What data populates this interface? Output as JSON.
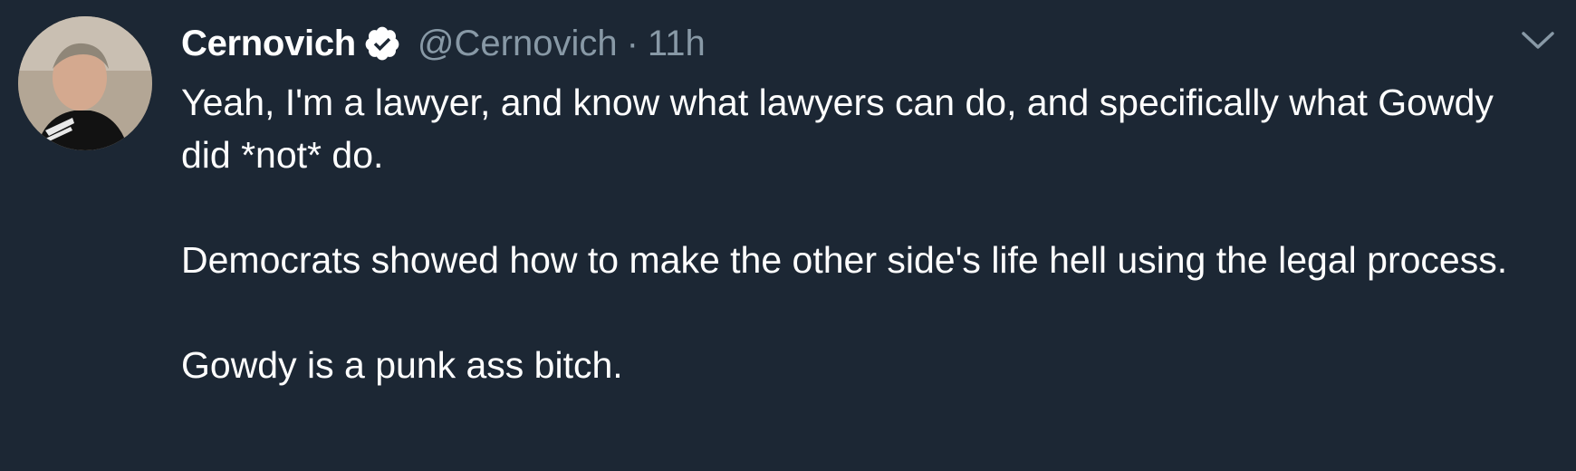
{
  "tweet": {
    "display_name": "Cernovich",
    "handle": "@Cernovich",
    "separator": "·",
    "time": "11h",
    "verified": true,
    "paragraphs": [
      "Yeah, I'm a lawyer, and know what lawyers can do, and specifically what Gowdy did *not* do.",
      "Democrats showed how to make the other side's life hell using the legal process.",
      "Gowdy is a punk ass bitch."
    ]
  },
  "colors": {
    "background": "#1c2734",
    "text": "#ffffff",
    "muted": "#8899a6"
  },
  "icons": {
    "verified": "verified-badge-icon",
    "caret": "chevron-down-icon"
  }
}
